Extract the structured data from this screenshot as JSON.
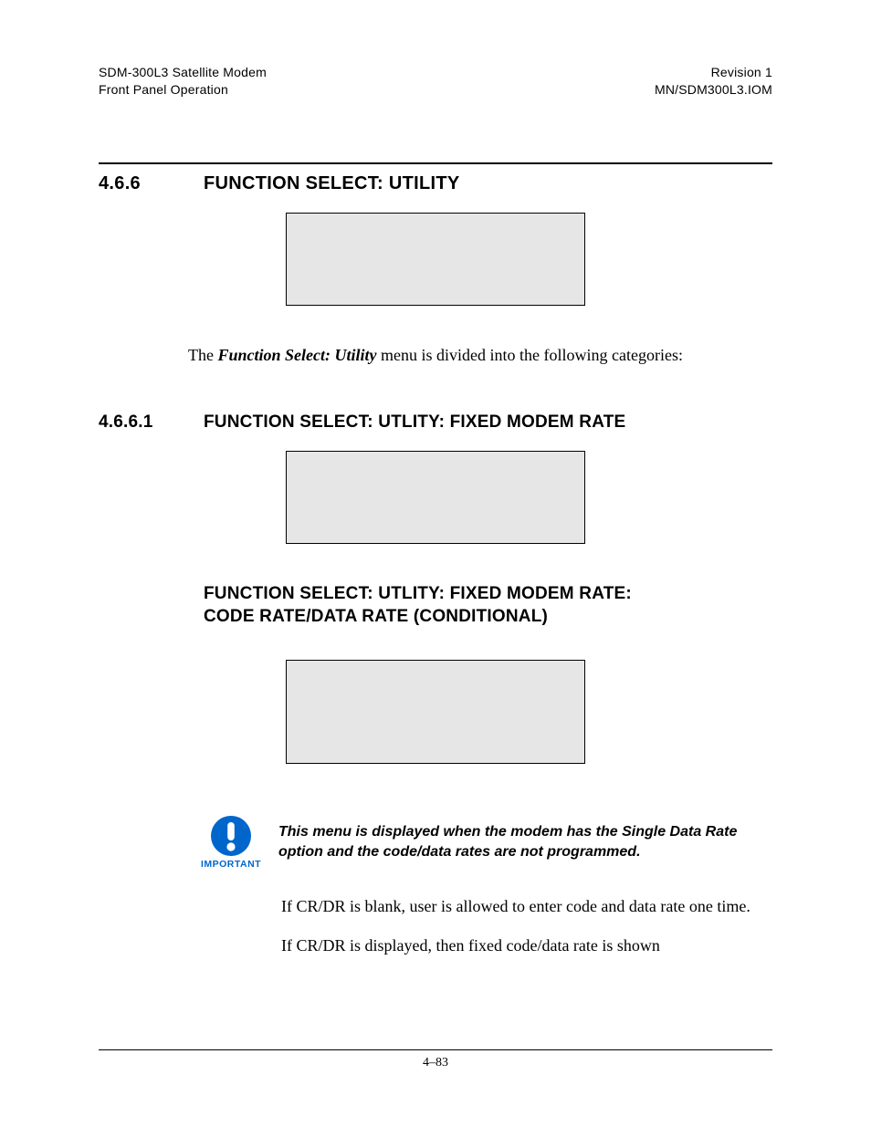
{
  "header": {
    "left_line1": "SDM-300L3 Satellite Modem",
    "left_line2": "Front Panel Operation",
    "right_line1": "Revision 1",
    "right_line2": "MN/SDM300L3.IOM"
  },
  "section466": {
    "num": "4.6.6",
    "title": "FUNCTION SELECT: UTILITY"
  },
  "intro": {
    "before": "The ",
    "emph": "Function Select: Utility",
    "after": " menu is divided into the following categories:"
  },
  "section4661": {
    "num": "4.6.6.1",
    "title": "FUNCTION SELECT: UTLITY: FIXED MODEM RATE"
  },
  "sub4661": {
    "line1": "FUNCTION SELECT: UTLITY: FIXED MODEM RATE:",
    "line2": "CODE RATE/DATA RATE (CONDITIONAL)"
  },
  "important": {
    "label": "IMPORTANT",
    "text": "This menu is displayed when the modem has the Single Data Rate option and the code/data rates are not programmed."
  },
  "body": {
    "p1": "If CR/DR is blank, user is allowed to enter code and data rate one time.",
    "p2": "If CR/DR is displayed, then fixed code/data rate is shown"
  },
  "footer": {
    "page": "4–83"
  }
}
